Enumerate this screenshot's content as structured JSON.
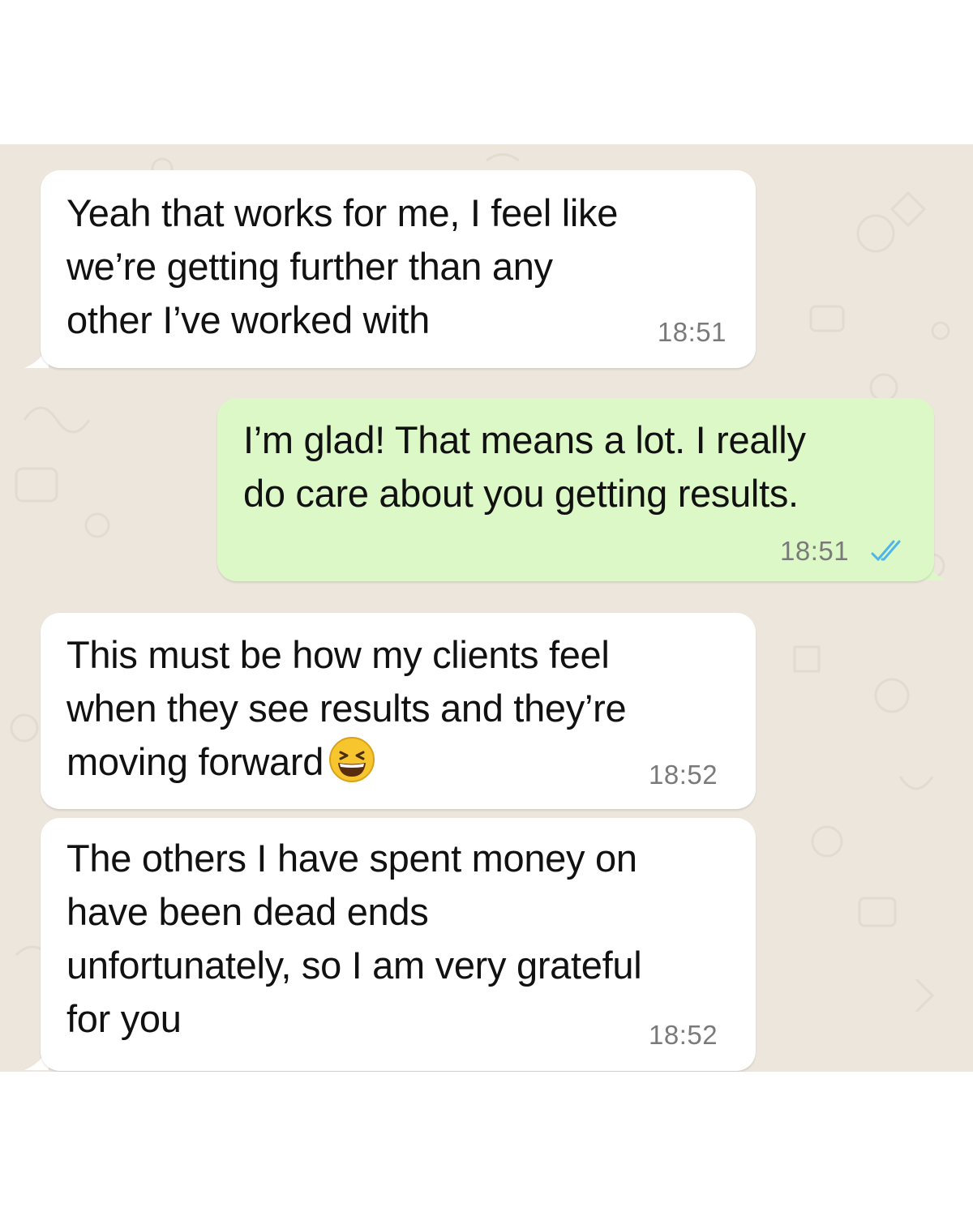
{
  "messages": [
    {
      "direction": "incoming",
      "text": "Yeah that works for me, I feel like\nwe’re getting further than any\nother I’ve worked with",
      "time": "18:51"
    },
    {
      "direction": "outgoing",
      "text": "I’m glad! That means a lot. I really\ndo care about you getting results.",
      "time": "18:51",
      "status": "read",
      "status_icon": "double-check-icon"
    },
    {
      "direction": "incoming",
      "text": "This must be how my clients feel\nwhen they see results and they’re\nmoving forward",
      "emoji": "grinning-squinting-face-icon",
      "time": "18:52"
    },
    {
      "direction": "incoming",
      "text": "The others I have spent money on\nhave been dead ends\nunfortunately, so I am very grateful\nfor you",
      "time": "18:52"
    }
  ],
  "colors": {
    "wallpaper": "#ece6dc",
    "incoming_bubble": "#ffffff",
    "outgoing_bubble": "#dcf8c6",
    "timestamp": "#7a7a7a",
    "read_ticks": "#4fb6ec"
  }
}
